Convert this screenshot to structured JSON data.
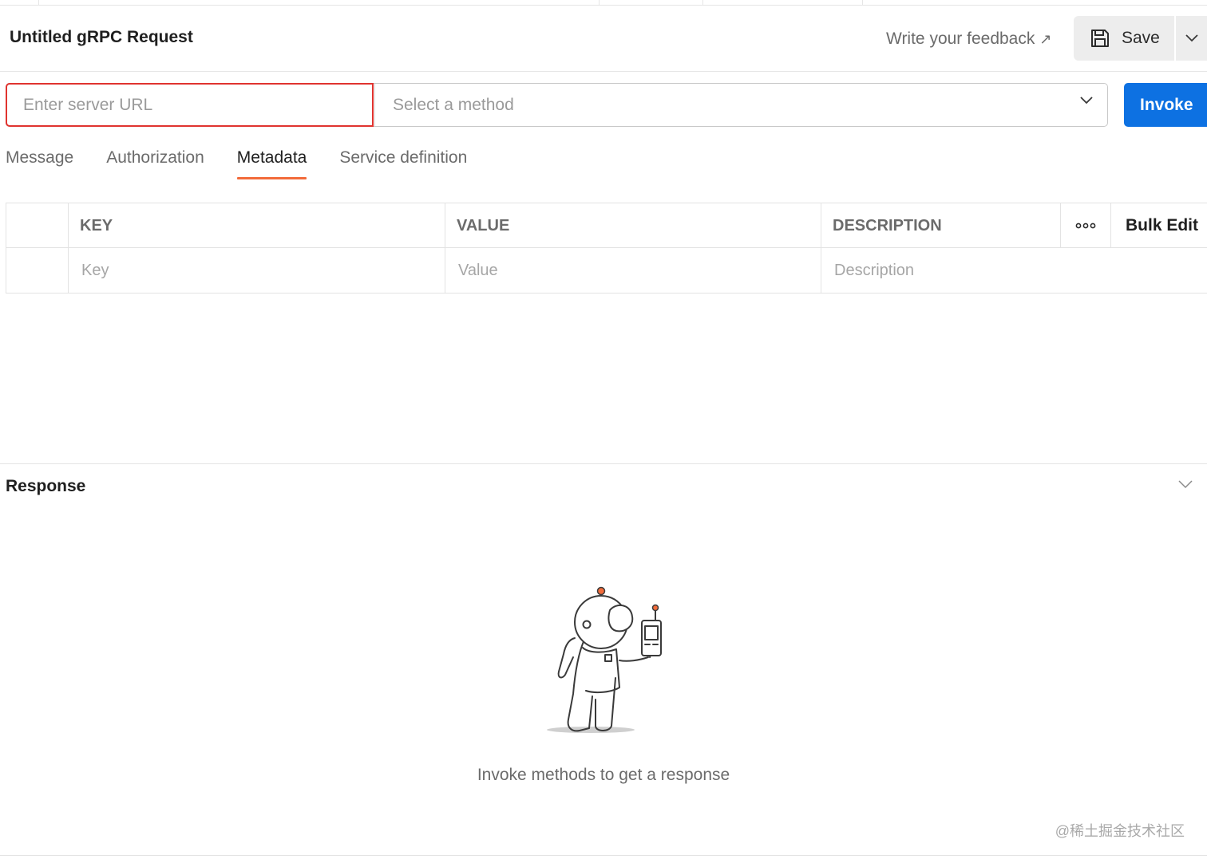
{
  "header": {
    "title": "Untitled gRPC Request",
    "feedback_label": "Write your feedback",
    "save_label": "Save"
  },
  "request": {
    "url_placeholder": "Enter server URL",
    "method_placeholder": "Select a method",
    "invoke_label": "Invoke"
  },
  "tabs": [
    {
      "label": "Message"
    },
    {
      "label": "Authorization"
    },
    {
      "label": "Metadata"
    },
    {
      "label": "Service definition"
    }
  ],
  "active_tab": "Metadata",
  "metadata_table": {
    "headers": {
      "key": "KEY",
      "value": "VALUE",
      "description": "DESCRIPTION"
    },
    "bulk_edit_label": "Bulk Edit",
    "placeholders": {
      "key": "Key",
      "value": "Value",
      "description": "Description"
    }
  },
  "response": {
    "title": "Response",
    "empty_message": "Invoke methods to get a response"
  },
  "watermark": "@稀土掘金技术社区",
  "colors": {
    "accent_tab": "#f26b3a",
    "invoke_button": "#0d71e2",
    "url_error_border": "#e0332f"
  }
}
